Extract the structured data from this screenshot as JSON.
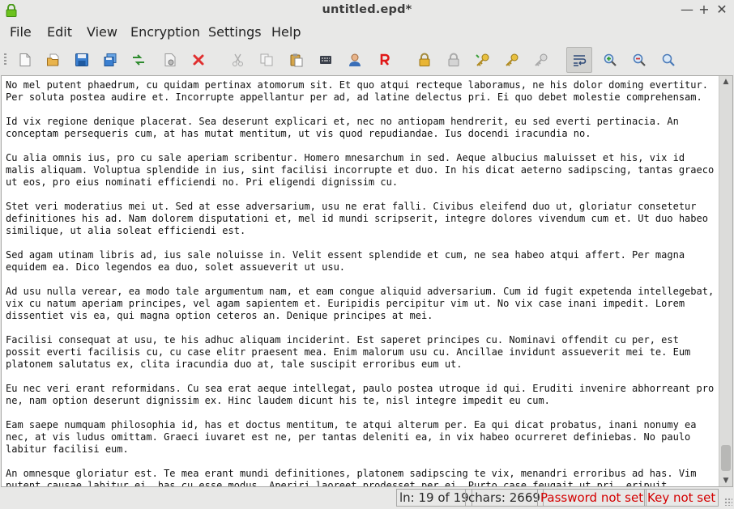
{
  "window": {
    "title": "untitled.epd*",
    "controls": {
      "minimize": "—",
      "maximize": "+",
      "close": "✕"
    },
    "app_icon": "green-lock-icon"
  },
  "menubar": [
    "File",
    "Edit",
    "View",
    "Encryption",
    "Settings",
    "Help"
  ],
  "toolbar": {
    "buttons": [
      "new-file-icon",
      "open-file-icon",
      "save-icon",
      "save-as-icon",
      "recent-files-icon",
      "file-properties-icon",
      "close-file-icon",
      "cut-icon",
      "copy-icon",
      "paste-icon",
      "keyboard-icon",
      "user-icon",
      "r-icon",
      "lock-icon",
      "unlock-icon",
      "key-icon",
      "key-alt-icon",
      "key-remove-icon",
      "word-wrap-icon",
      "zoom-in-icon",
      "zoom-out-icon",
      "find-icon"
    ],
    "active_button": "word-wrap-icon"
  },
  "editor": {
    "paragraphs": [
      "No mel putent phaedrum, cu quidam pertinax atomorum sit. Et quo atqui recteque laboramus, ne his dolor doming evertitur. Per soluta postea audire et. Incorrupte appellantur per ad, ad latine delectus pri. Ei quo debet molestie comprehensam.",
      "Id vix regione denique placerat. Sea deserunt explicari et, nec no antiopam hendrerit, eu sed everti pertinacia. An conceptam persequeris cum, at has mutat mentitum, ut vis quod repudiandae. Ius docendi iracundia no.",
      "Cu alia omnis ius, pro cu sale aperiam scribentur. Homero mnesarchum in sed. Aeque albucius maluisset et his, vix id malis aliquam. Voluptua splendide in ius, sint facilisi incorrupte et duo. In his dicat aeterno sadipscing, tantas graeco ut eos, pro eius nominati efficiendi no. Pri eligendi dignissim cu.",
      "Stet veri moderatius mei ut. Sed at esse adversarium, usu ne erat falli. Civibus eleifend duo ut, gloriatur consetetur definitiones his ad. Nam dolorem disputationi et, mel id mundi scripserit, integre dolores vivendum cum et. Ut duo habeo similique, ut alia soleat efficiendi est.",
      "Sed agam utinam libris ad, ius sale noluisse in. Velit essent splendide et cum, ne sea habeo atqui affert. Per magna equidem ea. Dico legendos ea duo, solet assueverit ut usu.",
      "Ad usu nulla verear, ea modo tale argumentum nam, et eam congue aliquid adversarium. Cum id fugit expetenda intellegebat, vix cu natum aperiam principes, vel agam sapientem et. Euripidis percipitur vim ut. No vix case inani impedit. Lorem dissentiet vis ea, qui magna option ceteros an. Denique principes at mei.",
      "Facilisi consequat at usu, te his adhuc aliquam inciderint. Est saperet principes cu. Nominavi offendit cu per, est possit everti facilisis cu, cu case elitr praesent mea. Enim malorum usu cu. Ancillae invidunt assueverit mei te. Eum platonem salutatus ex, clita iracundia duo at, tale suscipit erroribus eum ut.",
      "Eu nec veri erant reformidans. Cu sea erat aeque intellegat, paulo postea utroque id qui. Eruditi invenire abhorreant pro ne, nam option deserunt dignissim ex. Hinc laudem dicunt his te, nisl integre impedit eu cum.",
      "Eam saepe numquam philosophia id, has et doctus mentitum, te atqui alterum per. Ea qui dicat probatus, inani nonumy ea nec, at vis ludus omittam. Graeci iuvaret est ne, per tantas deleniti ea, in vix habeo ocurreret definiebas. No paulo labitur facilisi eum.",
      "An omnesque gloriatur est. Te mea erant mundi definitiones, platonem sadipscing te vix, menandri erroribus ad has. Vim putent causae labitur ei, has cu esse modus. Aperiri laoreet prodesset per ei. Purto case feugait ut pri, eripuit"
    ]
  },
  "statusbar": {
    "line": "ln: 19 of 19",
    "chars": "chars: 2669",
    "password": "Password not set",
    "key": "Key not set"
  },
  "colors": {
    "warning_text": "#d40000",
    "window_bg": "#e8e8e7",
    "editor_bg": "#ffffff"
  }
}
